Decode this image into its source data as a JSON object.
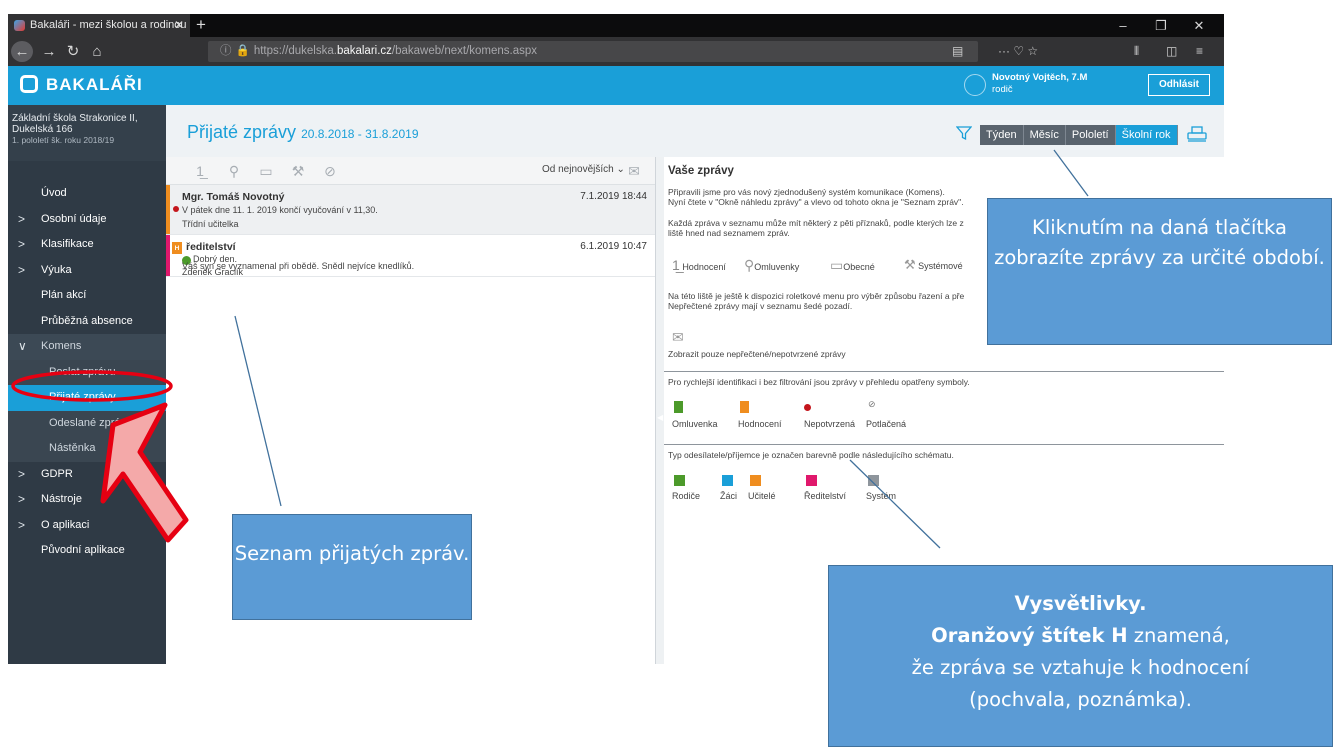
{
  "browser": {
    "tab_title": "Bakaláři - mezi školou a rodinou",
    "tab_close": "✕",
    "new_tab": "+",
    "url_prefix": "https://dukelska.",
    "url_domain": "bakalari.cz",
    "url_path": "/bakaweb/next/komens.aspx"
  },
  "app": {
    "brand": "BAKALÁŘI",
    "user_name": "Novotný Vojtěch, 7.M",
    "user_role": "rodič",
    "logout": "Odhlásit"
  },
  "sidebar": {
    "school_line1": "Základní škola Strakonice II,",
    "school_line2": "Dukelská 166",
    "term": "1. pololetí šk. roku 2018/19",
    "items": [
      {
        "label": "Úvod",
        "chevron": ""
      },
      {
        "label": "Osobní údaje",
        "chevron": ">"
      },
      {
        "label": "Klasifikace",
        "chevron": ">"
      },
      {
        "label": "Výuka",
        "chevron": ">"
      },
      {
        "label": "Plán akcí",
        "chevron": ""
      },
      {
        "label": "Průběžná absence",
        "chevron": ""
      },
      {
        "label": "Komens",
        "chevron": "∨"
      },
      {
        "label": "Poslat zprávu",
        "chevron": ""
      },
      {
        "label": "Přijaté zprávy",
        "chevron": ""
      },
      {
        "label": "Odeslané zprávy",
        "chevron": ""
      },
      {
        "label": "Nástěnka",
        "chevron": ""
      },
      {
        "label": "GDPR",
        "chevron": ">"
      },
      {
        "label": "Nástroje",
        "chevron": ">"
      },
      {
        "label": "O aplikaci",
        "chevron": ">"
      },
      {
        "label": "Původní aplikace",
        "chevron": ""
      }
    ]
  },
  "page": {
    "title": "Přijaté zprávy",
    "range": "20.8.2018 - 31.8.2019",
    "periods": [
      "Týden",
      "Měsíc",
      "Pololetí",
      "Školní rok"
    ],
    "sort_label": "Od nejnovějších"
  },
  "messages": [
    {
      "from": "Mgr. Tomáš Novotný",
      "date": "7.1.2019 18:44",
      "line1": "V pátek dne 11. 1. 2019 končí vyučování v 11,30.",
      "line2": "Třídní učitelka"
    },
    {
      "from": "ředitelství",
      "date": "6.1.2019 10:47",
      "line1": "Dobrý den.",
      "line2": "Váš syn se vyznamenal při obědě. Snědl nejvíce knedlíků.",
      "line3": "Zdeněk Graclík"
    }
  ],
  "preview": {
    "heading": "Vaše zprávy",
    "p1a": "Připravili jsme pro vás nový zjednodušený systém komunikace (Komens).",
    "p1b": "Nyní čtete v \"Okně náhledu zprávy\" a vlevo od tohoto okna je \"Seznam zpráv\".",
    "p2a": "Každá zpráva v seznamu může mít některý z pěti příznaků, podle kterých lze z",
    "p2b": "liště hned nad seznamem zpráv.",
    "flags": [
      "Hodnocení",
      "Omluvenky",
      "Obecné",
      "Systémové"
    ],
    "p3a": "Na této liště je ještě k dispozici roletkové menu pro výběr způsobu řazení a pře",
    "p3b": "Nepřečtené zprávy mají v seznamu šedé pozadí.",
    "unread_only": "Zobrazit pouze nepřečtené/nepotvrzené zprávy",
    "p4": "Pro rychlejší identifikaci i bez filtrování jsou zprávy v přehledu opatřeny symboly.",
    "symbols": [
      "Omluvenka",
      "Hodnocení",
      "Nepotvrzená",
      "Potlačená"
    ],
    "p5": "Typ odesílatele/příjemce je označen barevně podle následujícího schématu.",
    "senders": [
      {
        "label": "Rodiče",
        "color": "#4c9a2a"
      },
      {
        "label": "Žáci",
        "color": "#1a9fd8"
      },
      {
        "label": "Učitelé",
        "color": "#ef8d1f"
      },
      {
        "label": "Ředitelství",
        "color": "#e0186c"
      },
      {
        "label": "Systém",
        "color": "#8e959c"
      }
    ]
  },
  "annotations": {
    "periods_note": "Kliknutím na daná tlačítka zobrazíte zprávy za určité období.",
    "list_note": "Seznam přijatých zpráv.",
    "legend_title": "Vysvětlivky.",
    "legend_bold": "Oranžový štítek H",
    "legend_rest1": " znamená,",
    "legend_line2": "že zpráva se vztahuje k hodnocení",
    "legend_line3": "(pochvala, poznámka)."
  }
}
